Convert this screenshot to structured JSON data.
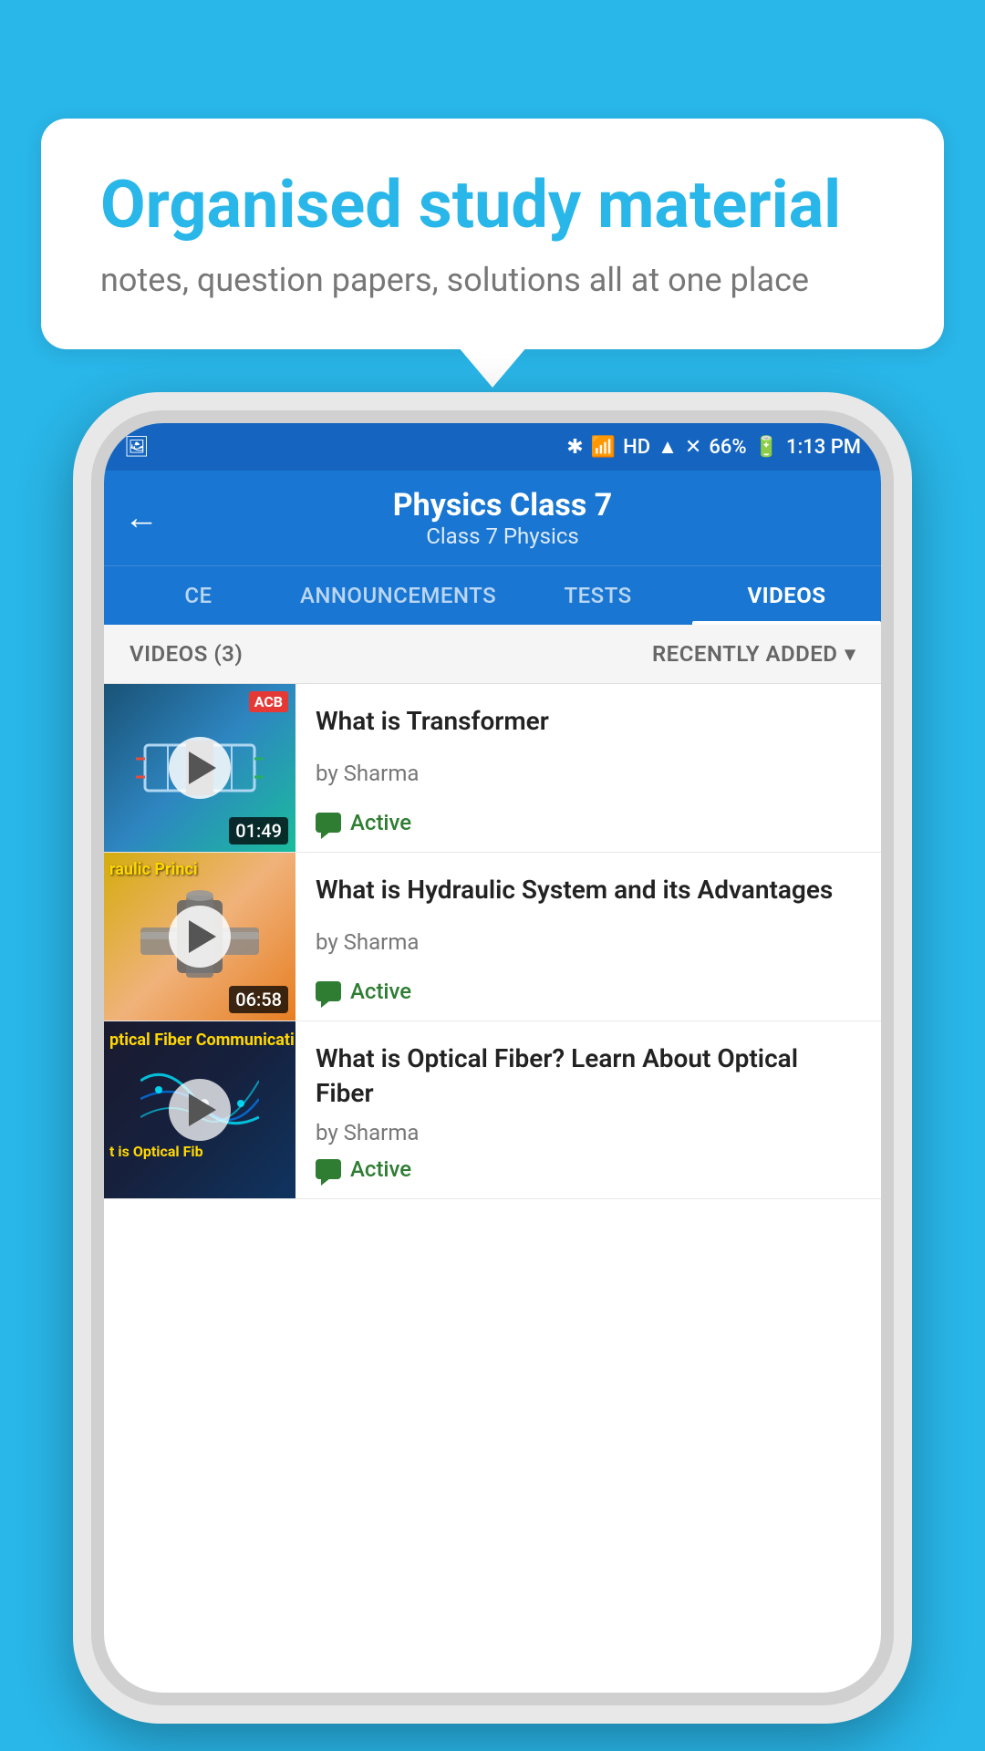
{
  "bubble": {
    "title": "Organised study material",
    "subtitle": "notes, question papers, solutions all at one place"
  },
  "status_bar": {
    "battery": "66%",
    "time": "1:13 PM"
  },
  "header": {
    "back_label": "←",
    "title": "Physics Class 7",
    "breadcrumb": "Class 7   Physics"
  },
  "tabs": [
    {
      "id": "ce",
      "label": "CE",
      "active": false
    },
    {
      "id": "announcements",
      "label": "ANNOUNCEMENTS",
      "active": false
    },
    {
      "id": "tests",
      "label": "TESTS",
      "active": false
    },
    {
      "id": "videos",
      "label": "VIDEOS",
      "active": true
    }
  ],
  "videos_section": {
    "count_label": "VIDEOS (3)",
    "sort_label": "RECENTLY ADDED"
  },
  "videos": [
    {
      "id": "transformer",
      "title": "What is  Transformer",
      "author": "by Sharma",
      "status": "Active",
      "duration": "01:49",
      "thumb_type": "transformer",
      "badge": "ACB"
    },
    {
      "id": "hydraulic",
      "title": "What is Hydraulic System and its Advantages",
      "author": "by Sharma",
      "status": "Active",
      "duration": "06:58",
      "thumb_type": "hydraulic",
      "thumb_text": "raulic Princi"
    },
    {
      "id": "fiber",
      "title": "What is Optical Fiber? Learn About Optical Fiber",
      "author": "by Sharma",
      "status": "Active",
      "duration": "",
      "thumb_type": "fiber",
      "thumb_text": "ptical Fiber Communicati",
      "thumb_subtext": "t is Optical Fib"
    }
  ]
}
